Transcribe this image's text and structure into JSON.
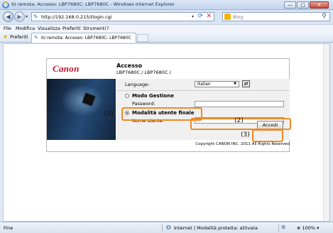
{
  "window": {
    "title": "IU remota: Accesso: LBP7680C: LBP7680C - Windows Internet Explorer",
    "minimize": "—",
    "maximize": "□",
    "close": "✕"
  },
  "browser": {
    "url": "http://192.168.0.215/tlogin.cgi",
    "search_placeholder": "Bing",
    "search_icon": "magnifier-icon",
    "menu": [
      "File",
      "Modifica",
      "Visualizza",
      "Preferiti",
      "Strumenti",
      "?"
    ],
    "favorites_label": "Preferiti",
    "tab_title": "IU remota: Accesso: LBP7680C: LBP7680C",
    "status_text": "Fine",
    "zone_text": "Internet | Modalità protetta: attivata",
    "zoom": "100%"
  },
  "login": {
    "logo": "Canon",
    "heading": "Accesso",
    "model": "LBP7680C / LBP7680C /",
    "language_label": "Language:",
    "language_value": "Italian",
    "mode_manager": "Modo Gestione",
    "password_label": "Password:",
    "mode_user": "Modalità utente finale",
    "username_label": "Nome utente:",
    "login_button": "Accedi",
    "copyright": "Copyright CANON INC. 2011 All Rights Reserved"
  },
  "callouts": [
    "(1)",
    "(2)",
    "(3)"
  ],
  "colors": {
    "highlight": "#f08a24",
    "canon_red": "#c8102e"
  }
}
